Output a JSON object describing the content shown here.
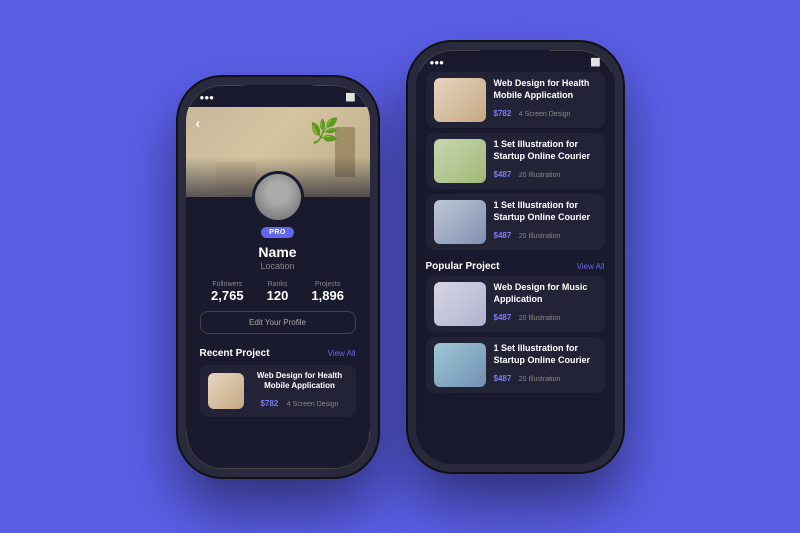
{
  "background_color": "#5B5FE8",
  "phone1": {
    "status": {
      "signal": "●●●",
      "wifi": "▲",
      "battery": "⬜"
    },
    "back_button": "‹",
    "profile": {
      "badge": "PRO",
      "name": "Name",
      "location": "Location",
      "stats": {
        "followers_label": "Followers",
        "followers_value": "2,765",
        "ranks_label": "Ranks",
        "ranks_value": "120",
        "projects_label": "Projects",
        "projects_value": "1,896"
      },
      "edit_button": "Edit Your Profile"
    },
    "recent_section": {
      "title": "Recent Project",
      "view_all": "View All"
    },
    "recent_project": {
      "title": "Web Design for Health Mobile Application",
      "price": "$782",
      "type": "4 Screen Design"
    }
  },
  "phone2": {
    "status": {
      "signal": "●●●",
      "wifi": "▲",
      "battery": "⬜"
    },
    "top_projects": [
      {
        "title": "Web Design for Health Mobile Application",
        "price": "$782",
        "type": "4 Screen Design",
        "thumb": "health"
      },
      {
        "title": "1 Set Illustration for Startup Online Courier",
        "price": "$487",
        "type": "20 Illustration",
        "thumb": "startup1"
      },
      {
        "title": "1 Set Illustration for Startup Online Courier",
        "price": "$487",
        "type": "20 Illustration",
        "thumb": "startup2"
      }
    ],
    "popular_section": {
      "title": "Popular Project",
      "view_all": "View All"
    },
    "popular_projects": [
      {
        "title": "Web Design for Music Application",
        "price": "$487",
        "type": "20 Illustration",
        "thumb": "music"
      },
      {
        "title": "1 Set Illustration for Startup Online Courier",
        "price": "$487",
        "type": "20 Illustration",
        "thumb": "startup3"
      }
    ]
  }
}
